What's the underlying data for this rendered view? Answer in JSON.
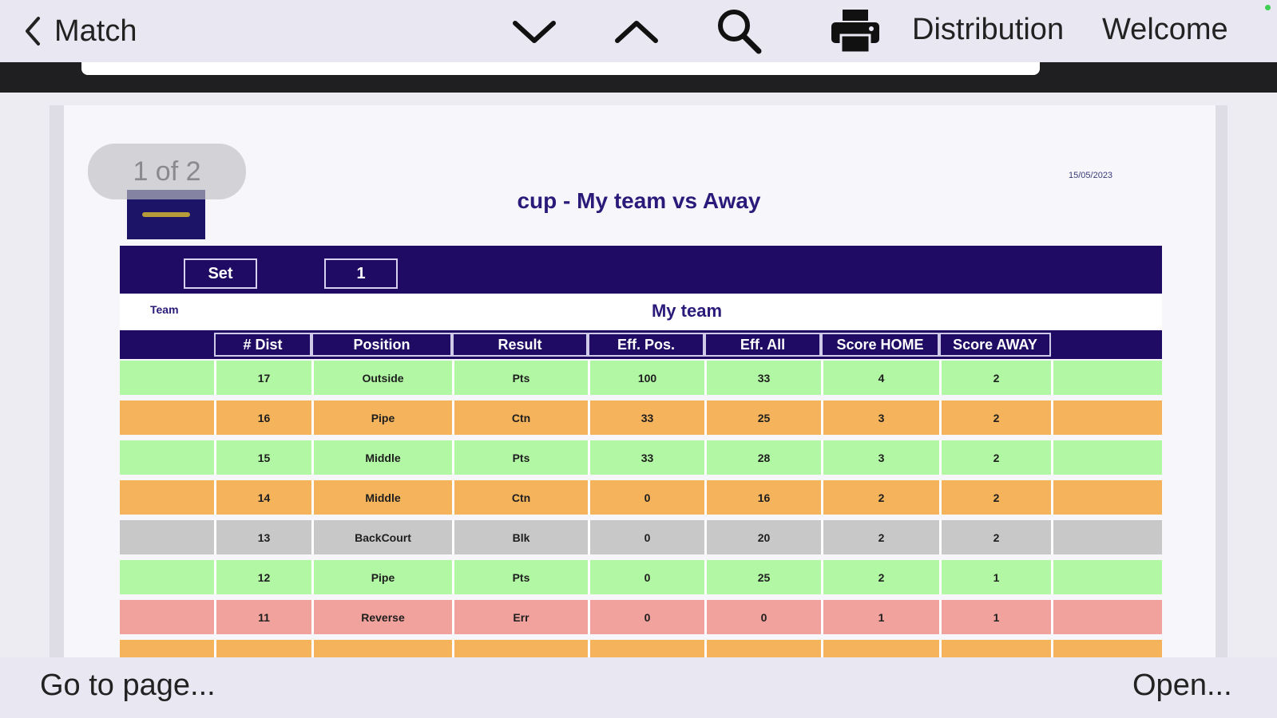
{
  "toolbar": {
    "back_label": "Match",
    "distribution_label": "Distribution",
    "welcome_label": "Welcome"
  },
  "page_indicator": "1 of 2",
  "report": {
    "date": "15/05/2023",
    "title": "cup - My team vs Away",
    "set_label": "Set",
    "set_value": "1",
    "team_label": "Team",
    "team_name": "My team"
  },
  "table": {
    "columns": [
      "# Dist",
      "Position",
      "Result",
      "Eff. Pos.",
      "Eff. All",
      "Score HOME",
      "Score AWAY"
    ],
    "rows": [
      {
        "dist": "17",
        "position": "Outside",
        "result": "Pts",
        "eff_pos": "100",
        "eff_all": "33",
        "score_home": "4",
        "score_away": "2",
        "color": "#b2f7a4"
      },
      {
        "dist": "16",
        "position": "Pipe",
        "result": "Ctn",
        "eff_pos": "33",
        "eff_all": "25",
        "score_home": "3",
        "score_away": "2",
        "color": "#f5b45c"
      },
      {
        "dist": "15",
        "position": "Middle",
        "result": "Pts",
        "eff_pos": "33",
        "eff_all": "28",
        "score_home": "3",
        "score_away": "2",
        "color": "#b2f7a4"
      },
      {
        "dist": "14",
        "position": "Middle",
        "result": "Ctn",
        "eff_pos": "0",
        "eff_all": "16",
        "score_home": "2",
        "score_away": "2",
        "color": "#f5b45c"
      },
      {
        "dist": "13",
        "position": "BackCourt",
        "result": "Blk",
        "eff_pos": "0",
        "eff_all": "20",
        "score_home": "2",
        "score_away": "2",
        "color": "#c8c8c8"
      },
      {
        "dist": "12",
        "position": "Pipe",
        "result": "Pts",
        "eff_pos": "0",
        "eff_all": "25",
        "score_home": "2",
        "score_away": "1",
        "color": "#b2f7a4"
      },
      {
        "dist": "11",
        "position": "Reverse",
        "result": "Err",
        "eff_pos": "0",
        "eff_all": "0",
        "score_home": "1",
        "score_away": "1",
        "color": "#f2a29c"
      },
      {
        "dist": "",
        "position": "",
        "result": "",
        "eff_pos": "",
        "eff_all": "",
        "score_home": "",
        "score_away": "",
        "color": "#f5b45c"
      }
    ]
  },
  "bottombar": {
    "goto_label": "Go to page...",
    "open_label": "Open..."
  },
  "colors": {
    "header_navy": "#1f0b63",
    "title_purple": "#2b1a7a",
    "row_green": "#b2f7a4",
    "row_orange": "#f5b45c",
    "row_gray": "#c8c8c8",
    "row_red": "#f2a29c"
  }
}
